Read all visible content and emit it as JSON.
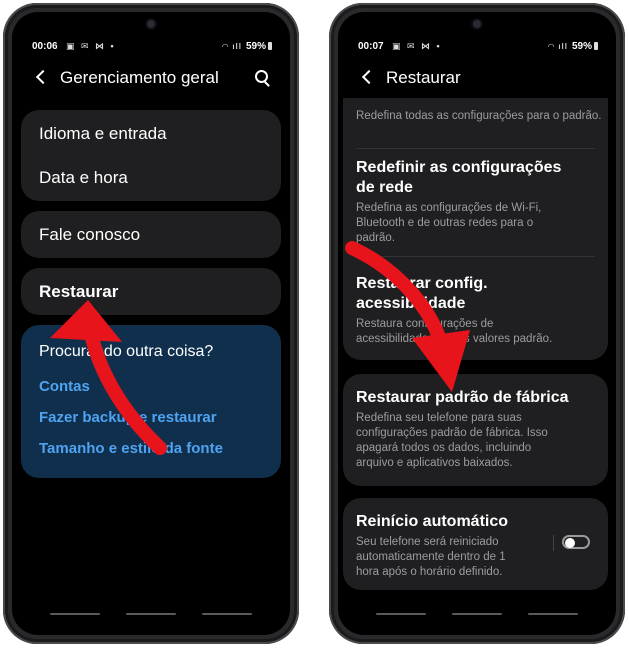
{
  "colors": {
    "background": "#000000",
    "card": "#1f1f21",
    "blue_card": "#0f2f4d",
    "link": "#4fa3f1",
    "description": "#9d9d9f",
    "arrow": "#e8141b"
  },
  "left_screen": {
    "status": {
      "time": "00:06",
      "notif_icons": "▣ ✉ ⋈ •",
      "battery": "59%"
    },
    "header": {
      "title": "Gerenciamento geral",
      "back_icon": "chevron-left",
      "search_icon": "magnifier"
    },
    "items": [
      {
        "label": "Idioma e entrada"
      },
      {
        "label": "Data e hora"
      },
      {
        "label": "Fale conosco"
      },
      {
        "label": "Restaurar"
      }
    ],
    "suggestions": {
      "label": "Procurando outra coisa?",
      "links": [
        "Contas",
        "Fazer backup e restaurar",
        "Tamanho e estilo da fonte"
      ]
    }
  },
  "right_screen": {
    "status": {
      "time": "00:07",
      "notif_icons": "▣ ✉ ⋈ •",
      "battery": "59%"
    },
    "header": {
      "title": "Restaurar",
      "back_icon": "chevron-left"
    },
    "options": [
      {
        "desc": "Redefina todas as configurações para o padrão."
      },
      {
        "title_l1": "Redefinir as configurações",
        "title_l2": "de rede",
        "desc_l1": "Redefina as configurações de Wi-Fi,",
        "desc_l2": "Bluetooth e de outras redes para o",
        "desc_l3": "padrão."
      },
      {
        "title_l1": "Restaurar config.",
        "title_l2": "acessibilidade",
        "desc_l1": "Restaura configurações de",
        "desc_l2": "acessibilidade para os valores padrão."
      },
      {
        "title": "Restaurar padrão de fábrica",
        "desc_l1": "Redefina seu telefone para suas",
        "desc_l2": "configurações padrão de fábrica. Isso",
        "desc_l3": "apagará todos os dados, incluindo",
        "desc_l4": "arquivo e aplicativos baixados."
      },
      {
        "title": "Reinício automático",
        "desc_l1": "Seu telefone será reiniciado",
        "desc_l2": "automaticamente dentro de 1",
        "desc_l3": "hora após o horário definido.",
        "toggle_on": false
      }
    ]
  }
}
